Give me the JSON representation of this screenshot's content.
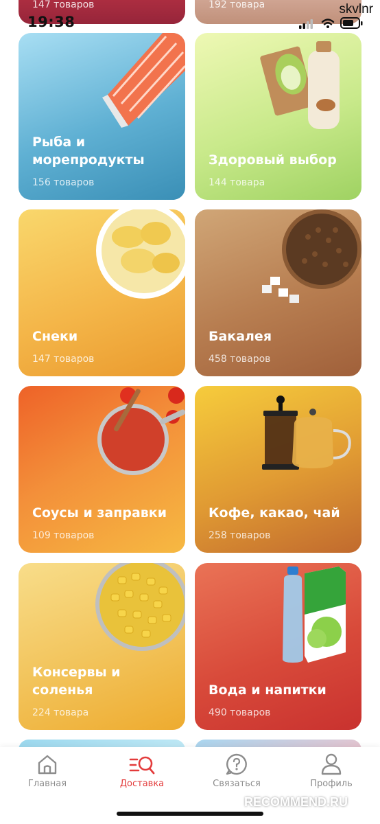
{
  "status_bar": {
    "time": "19:38",
    "username": "skvlnr"
  },
  "top_partial_cards": [
    {
      "count": "147 товаров",
      "color": "#a02a3a"
    },
    {
      "count": "192 товара",
      "color": "#c89a86"
    }
  ],
  "categories": [
    {
      "title": "Рыба и морепродукты",
      "count": "156 товаров",
      "color_top": "#9dd7f0",
      "color_bottom": "#3a8fb6",
      "image": "salmon-fillet"
    },
    {
      "title": "Здоровый выбор",
      "count": "144 товара",
      "color_top": "#e8f6a5",
      "color_bottom": "#9fd262",
      "image": "avocado-crispbread-and-milk"
    },
    {
      "title": "Снеки",
      "count": "147 товаров",
      "color_top": "#f7c65a",
      "color_bottom": "#ea9a2e",
      "image": "potato-chips-bowl"
    },
    {
      "title": "Бакалея",
      "count": "458 товаров",
      "color_top": "#c99a6c",
      "color_bottom": "#a0603a",
      "image": "buckwheat-and-sugar"
    },
    {
      "title": "Соусы и заправки",
      "count": "109 товаров",
      "color_top": "#ef6a2c",
      "color_bottom": "#f5b340",
      "image": "tomato-sauce-pan"
    },
    {
      "title": "Кофе, какао, чай",
      "count": "258 товаров",
      "color_top": "#f3c437",
      "color_bottom": "#c16a2e",
      "image": "french-press-and-teapot"
    },
    {
      "title": "Консервы и соленья",
      "count": "224 товара",
      "color_top": "#f6d780",
      "color_bottom": "#eeab2f",
      "image": "canned-corn"
    },
    {
      "title": "Вода и напитки",
      "count": "490 товаров",
      "color_top": "#e66a4e",
      "color_bottom": "#c9322f",
      "image": "water-and-juice"
    }
  ],
  "bottom_nav": [
    {
      "label": "Главная",
      "icon": "home-icon",
      "active": false
    },
    {
      "label": "Доставка",
      "icon": "catalog-search-icon",
      "active": true
    },
    {
      "label": "Связаться",
      "icon": "help-chat-icon",
      "active": false
    },
    {
      "label": "Профиль",
      "icon": "profile-icon",
      "active": false
    }
  ],
  "colors": {
    "accent": "#e33b3b",
    "nav_inactive": "#8c8c8c"
  },
  "watermark": "RECOMMEND.RU"
}
